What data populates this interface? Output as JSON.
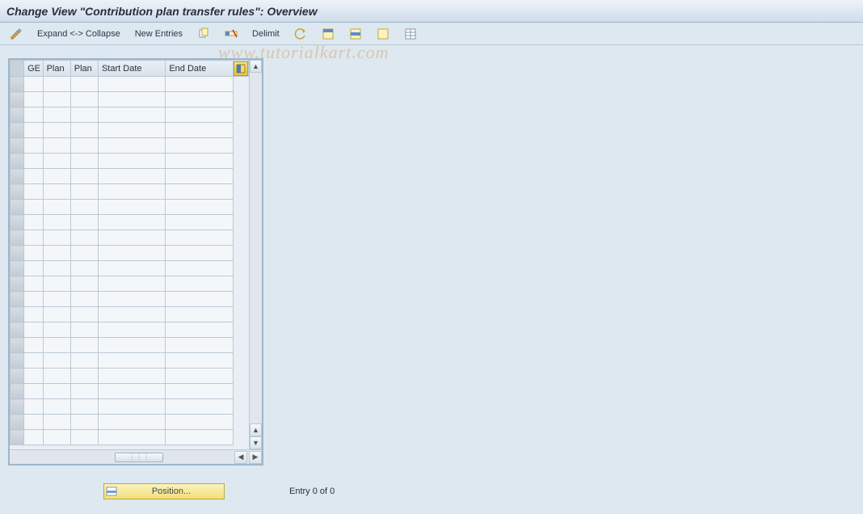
{
  "title": "Change View \"Contribution plan transfer rules\": Overview",
  "toolbar": {
    "expand_collapse": "Expand <-> Collapse",
    "new_entries": "New Entries",
    "delimit": "Delimit"
  },
  "table": {
    "columns": {
      "ge": "GE",
      "plan1": "Plan",
      "plan2": "Plan",
      "start_date": "Start Date",
      "end_date": "End Date"
    },
    "row_count": 24
  },
  "position_button": "Position...",
  "status_text": "Entry 0 of 0",
  "watermark": "www.tutorialkart.com"
}
